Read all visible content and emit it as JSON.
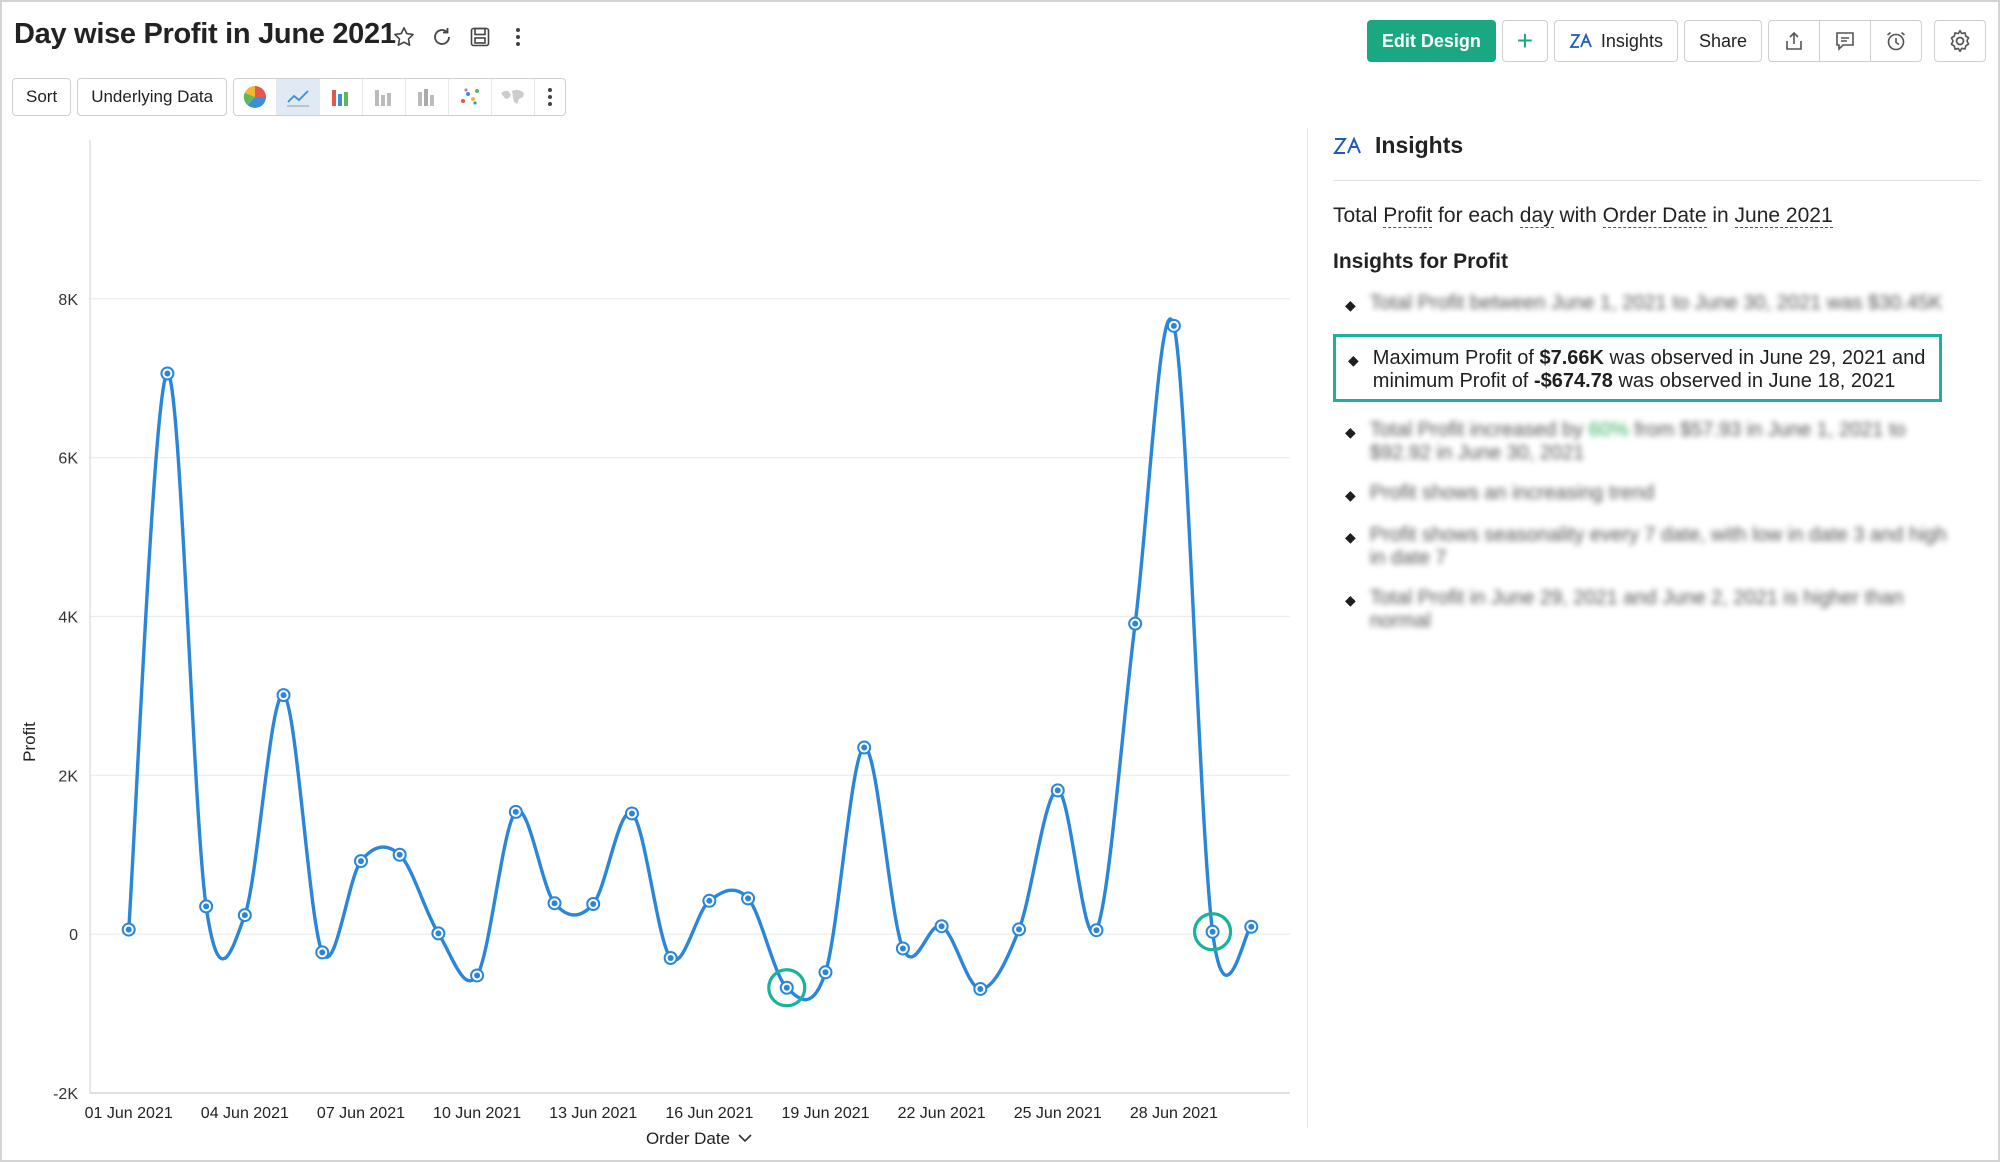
{
  "title": "Day wise Profit in June 2021",
  "toolbar": {
    "edit_design": "Edit Design",
    "add": "+",
    "insights": "Insights",
    "share": "Share",
    "sort": "Sort",
    "underlying_data": "Underlying Data"
  },
  "colors": {
    "accent": "#1aa883",
    "line": "#2a86d8",
    "highlight": "#1ab29a"
  },
  "chart_data": {
    "type": "line",
    "xlabel": "Order Date",
    "ylabel": "Profit",
    "ylim": [
      -2000,
      10000
    ],
    "yticks": [
      -2000,
      0,
      2000,
      4000,
      6000,
      8000
    ],
    "ytick_labels": [
      "-2K",
      "0",
      "2K",
      "4K",
      "6K",
      "8K"
    ],
    "x_tick_labels": [
      "01 Jun 2021",
      "04 Jun 2021",
      "07 Jun 2021",
      "10 Jun 2021",
      "13 Jun 2021",
      "16 Jun 2021",
      "19 Jun 2021",
      "22 Jun 2021",
      "25 Jun 2021",
      "28 Jun 2021"
    ],
    "x": [
      1,
      2,
      3,
      4,
      5,
      6,
      7,
      8,
      9,
      10,
      11,
      12,
      13,
      14,
      15,
      16,
      17,
      18,
      19,
      20,
      21,
      22,
      23,
      24,
      25,
      26,
      27,
      28,
      29,
      30
    ],
    "values": [
      57.93,
      7060,
      350,
      240,
      3010,
      -230,
      920,
      1000,
      10,
      -520,
      1540,
      390,
      380,
      1520,
      -300,
      420,
      450,
      -674.78,
      -480,
      2350,
      -180,
      100,
      -690,
      60,
      1810,
      50,
      3910,
      7660,
      30,
      92.92
    ],
    "grid": true,
    "highlighted_points": [
      18,
      29
    ]
  },
  "insights": {
    "header": "Insights",
    "desc": {
      "p1": "Total ",
      "measure": "Profit",
      "p2": " for each ",
      "unit": "day",
      "p3": " with ",
      "dim": "Order Date",
      "p4": " in ",
      "period": "June 2021"
    },
    "subheader": "Insights for Profit",
    "items": [
      {
        "text": "Total Profit between June 1, 2021 to June 30, 2021 was $30.45K"
      },
      {
        "pre": "Maximum Profit of ",
        "b1": "$7.66K",
        "mid": " was observed in June 29, 2021 and minimum Profit of ",
        "b2": "-$674.78",
        "post": " was observed in June 18, 2021"
      },
      {
        "pre": "Total Profit increased by ",
        "pct": "60%",
        "post": " from $57.93 in June 1, 2021 to $92.92 in June 30, 2021"
      },
      {
        "text": "Profit shows an increasing trend"
      },
      {
        "text": "Profit shows seasonality every 7 date, with low in date 3 and high in date 7"
      },
      {
        "text": "Total Profit in June 29, 2021 and June 2, 2021 is higher than normal"
      }
    ]
  }
}
